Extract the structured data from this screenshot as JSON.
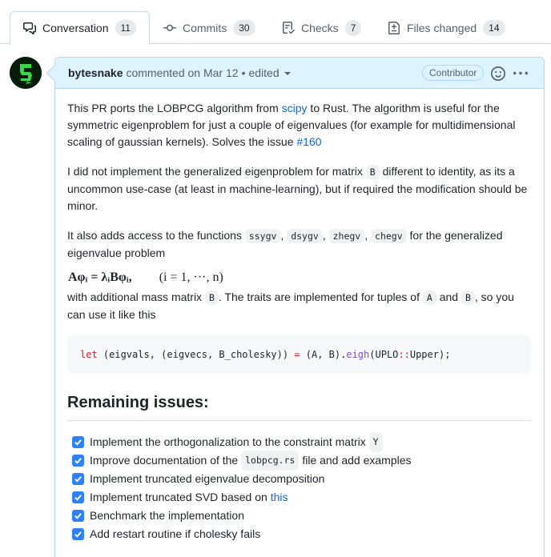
{
  "tabs": [
    {
      "label": "Conversation",
      "count": "11",
      "icon": "comment-discussion-icon"
    },
    {
      "label": "Commits",
      "count": "30",
      "icon": "git-commit-icon"
    },
    {
      "label": "Checks",
      "count": "7",
      "icon": "checklist-icon"
    },
    {
      "label": "Files changed",
      "count": "14",
      "icon": "file-diff-icon"
    }
  ],
  "comment": {
    "author": "bytesnake",
    "action": "commented on Mar 12",
    "separator": "•",
    "edited": "edited",
    "role": "Contributor"
  },
  "body": {
    "p1_a": "This PR ports the LOBPCG algorithm from ",
    "p1_link": "scipy",
    "p1_b": " to Rust. The algorithm is useful for the symmetric eigenproblem for just a couple of eigenvalues (for example for multidimensional scaling of gaussian kernels). Solves the issue ",
    "p1_issue": "#160",
    "p2_a": "I did not implement the generalized eigenproblem for matrix ",
    "p2_code": "B",
    "p2_b": " different to identity, as its a uncommon use-case (at least in machine-learning), but if required the modification should be minor.",
    "p3_a": "It also adds access to the functions ",
    "p3_codes": [
      "ssygv",
      "dsygv",
      "zhegv",
      "chegv"
    ],
    "p3_sep": ", ",
    "p3_b": " for the generalized eigenvalue problem",
    "math_lhs": "Aφᵢ = λᵢBφᵢ,",
    "math_rhs": "(i = 1, ···, n)",
    "p4_a": "with additional mass matrix ",
    "p4_code1": "B",
    "p4_b": ". The traits are implemented for tuples of ",
    "p4_code2": "A",
    "p4_c": " and ",
    "p4_code3": "B",
    "p4_d": ", so you can use it like this",
    "code": {
      "kw": "let",
      "t1": " (eigvals, (eigvecs, B_cholesky)) ",
      "eq": "=",
      "t2": " (A, B).",
      "fn": "eigh",
      "t3": "(UPLO",
      "op": "::",
      "t4": "Upper);"
    },
    "heading": "Remaining issues:",
    "tasks": [
      {
        "text": "Implement the orthogonalization to the constraint matrix ",
        "code": "Y",
        "after": "",
        "link": "",
        "checked": true
      },
      {
        "text": "Improve documentation of the ",
        "code": "lobpcg.rs",
        "after": " file and add examples",
        "link": "",
        "checked": true
      },
      {
        "text": "Implement truncated eigenvalue decomposition",
        "code": "",
        "after": "",
        "link": "",
        "checked": true
      },
      {
        "text": "Implement truncated SVD based on ",
        "code": "",
        "after": "",
        "link": "this",
        "checked": true
      },
      {
        "text": "Benchmark the implementation",
        "code": "",
        "after": "",
        "link": "",
        "checked": true
      },
      {
        "text": "Add restart routine if cholesky fails",
        "code": "",
        "after": "",
        "link": "",
        "checked": true
      }
    ]
  },
  "colors": {
    "accent": "#0969da",
    "header_bg": "#ddf4ff",
    "checkbox": "#2f81f7"
  }
}
